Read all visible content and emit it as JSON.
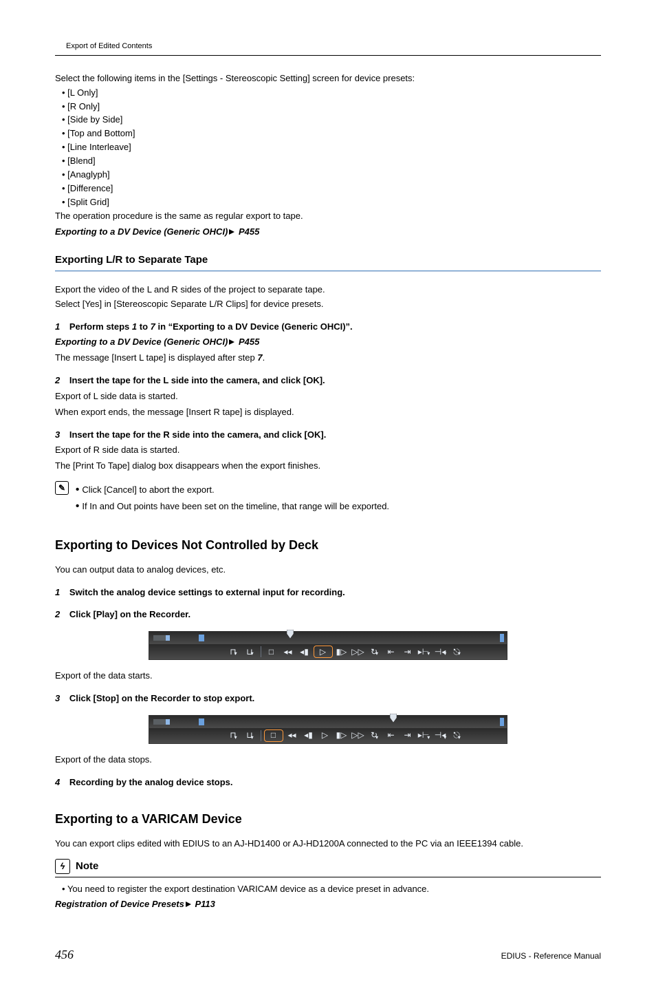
{
  "breadcrumb": "Export of Edited Contents",
  "intro": "Select the following items in the [Settings - Stereoscopic Setting] screen for device presets:",
  "options": [
    "[L Only]",
    "[R Only]",
    "[Side by Side]",
    "[Top and Bottom]",
    "[Line Interleave]",
    "[Blend]",
    "[Anaglyph]",
    "[Difference]",
    "[Split Grid]"
  ],
  "intro_after": "The operation procedure is the same as regular export to tape.",
  "ref1_a": "Exporting to a DV Device (Generic OHCI)",
  "ref1_b": "P455",
  "sec1": {
    "title": "Exporting L/R to Separate Tape",
    "p1": "Export the video of the L and R sides of the project to separate tape.",
    "p2": "Select [Yes] in [Stereoscopic   Separate L/R Clips] for device presets.",
    "s1_pre": "Perform steps ",
    "s1_n1": "1",
    "s1_mid": " to ",
    "s1_n2": "7",
    "s1_post": " in “Exporting to a DV Device (Generic OHCI)”.",
    "ref_a": "Exporting to a DV Device (Generic OHCI)",
    "ref_b": "P455",
    "s1_after_a": "The message [Insert L tape] is displayed after step ",
    "s1_after_b": "7",
    "s1_after_c": ".",
    "s2": "Insert the tape for the L side into the camera, and click [OK].",
    "s2a": "Export of L side data is started.",
    "s2b": "When export ends, the message [Insert R tape] is displayed.",
    "s3": "Insert the tape for the R side into the camera, and click [OK].",
    "s3a": "Export of R side data is started.",
    "s3b": "The [Print To Tape] dialog box disappears when the export finishes.",
    "info": [
      "Click [Cancel] to abort the export.",
      "If In and Out points have been set on the timeline, that range will be exported."
    ]
  },
  "sec2": {
    "title": "Exporting to Devices Not Controlled by Deck",
    "p1": "You can output data to analog devices, etc.",
    "s1": "Switch the analog device settings to external input for recording.",
    "s2": "Click [Play] on the Recorder.",
    "s2a": "Export of the data starts.",
    "s3": "Click [Stop] on the Recorder to stop export.",
    "s3a": "Export of the data stops.",
    "s4": "Recording by the analog device stops."
  },
  "sec3": {
    "title": "Exporting to a VARICAM Device",
    "p1": "You can export clips edited with EDIUS to an AJ-HD1400 or AJ-HD1200A connected to the PC via an IEEE1394 cable.",
    "note_label": "Note",
    "note1": "You need to register the export destination VARICAM device as a device preset in advance.",
    "ref_a": "Registration of Device Presets",
    "ref_b": "P113"
  },
  "nums": {
    "n1": "1",
    "n2": "2",
    "n3": "3",
    "n4": "4"
  },
  "footer": {
    "page": "456",
    "manual": "EDIUS - Reference Manual"
  }
}
